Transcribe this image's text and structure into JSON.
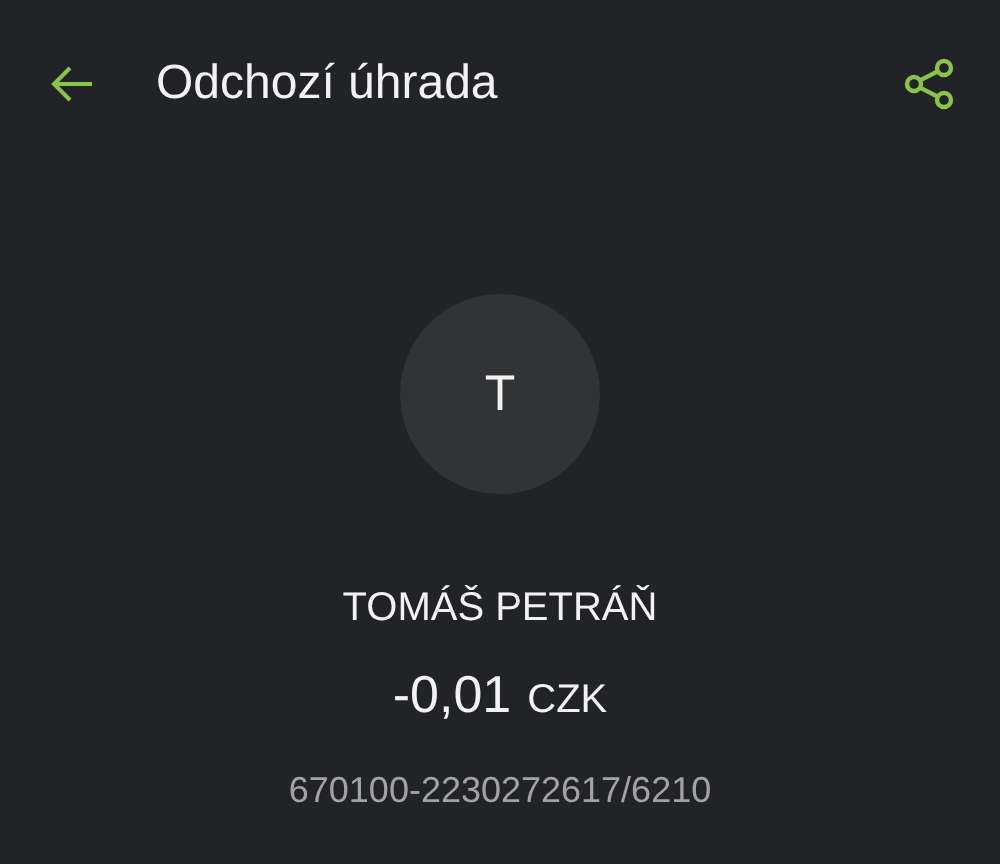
{
  "header": {
    "title": "Odchozí úhrada"
  },
  "avatar": {
    "initial": "T"
  },
  "payee": {
    "name": "TOMÁŠ PETRÁŇ",
    "amount": "-0,01",
    "currency": "CZK",
    "account": "670100-2230272617/6210"
  }
}
